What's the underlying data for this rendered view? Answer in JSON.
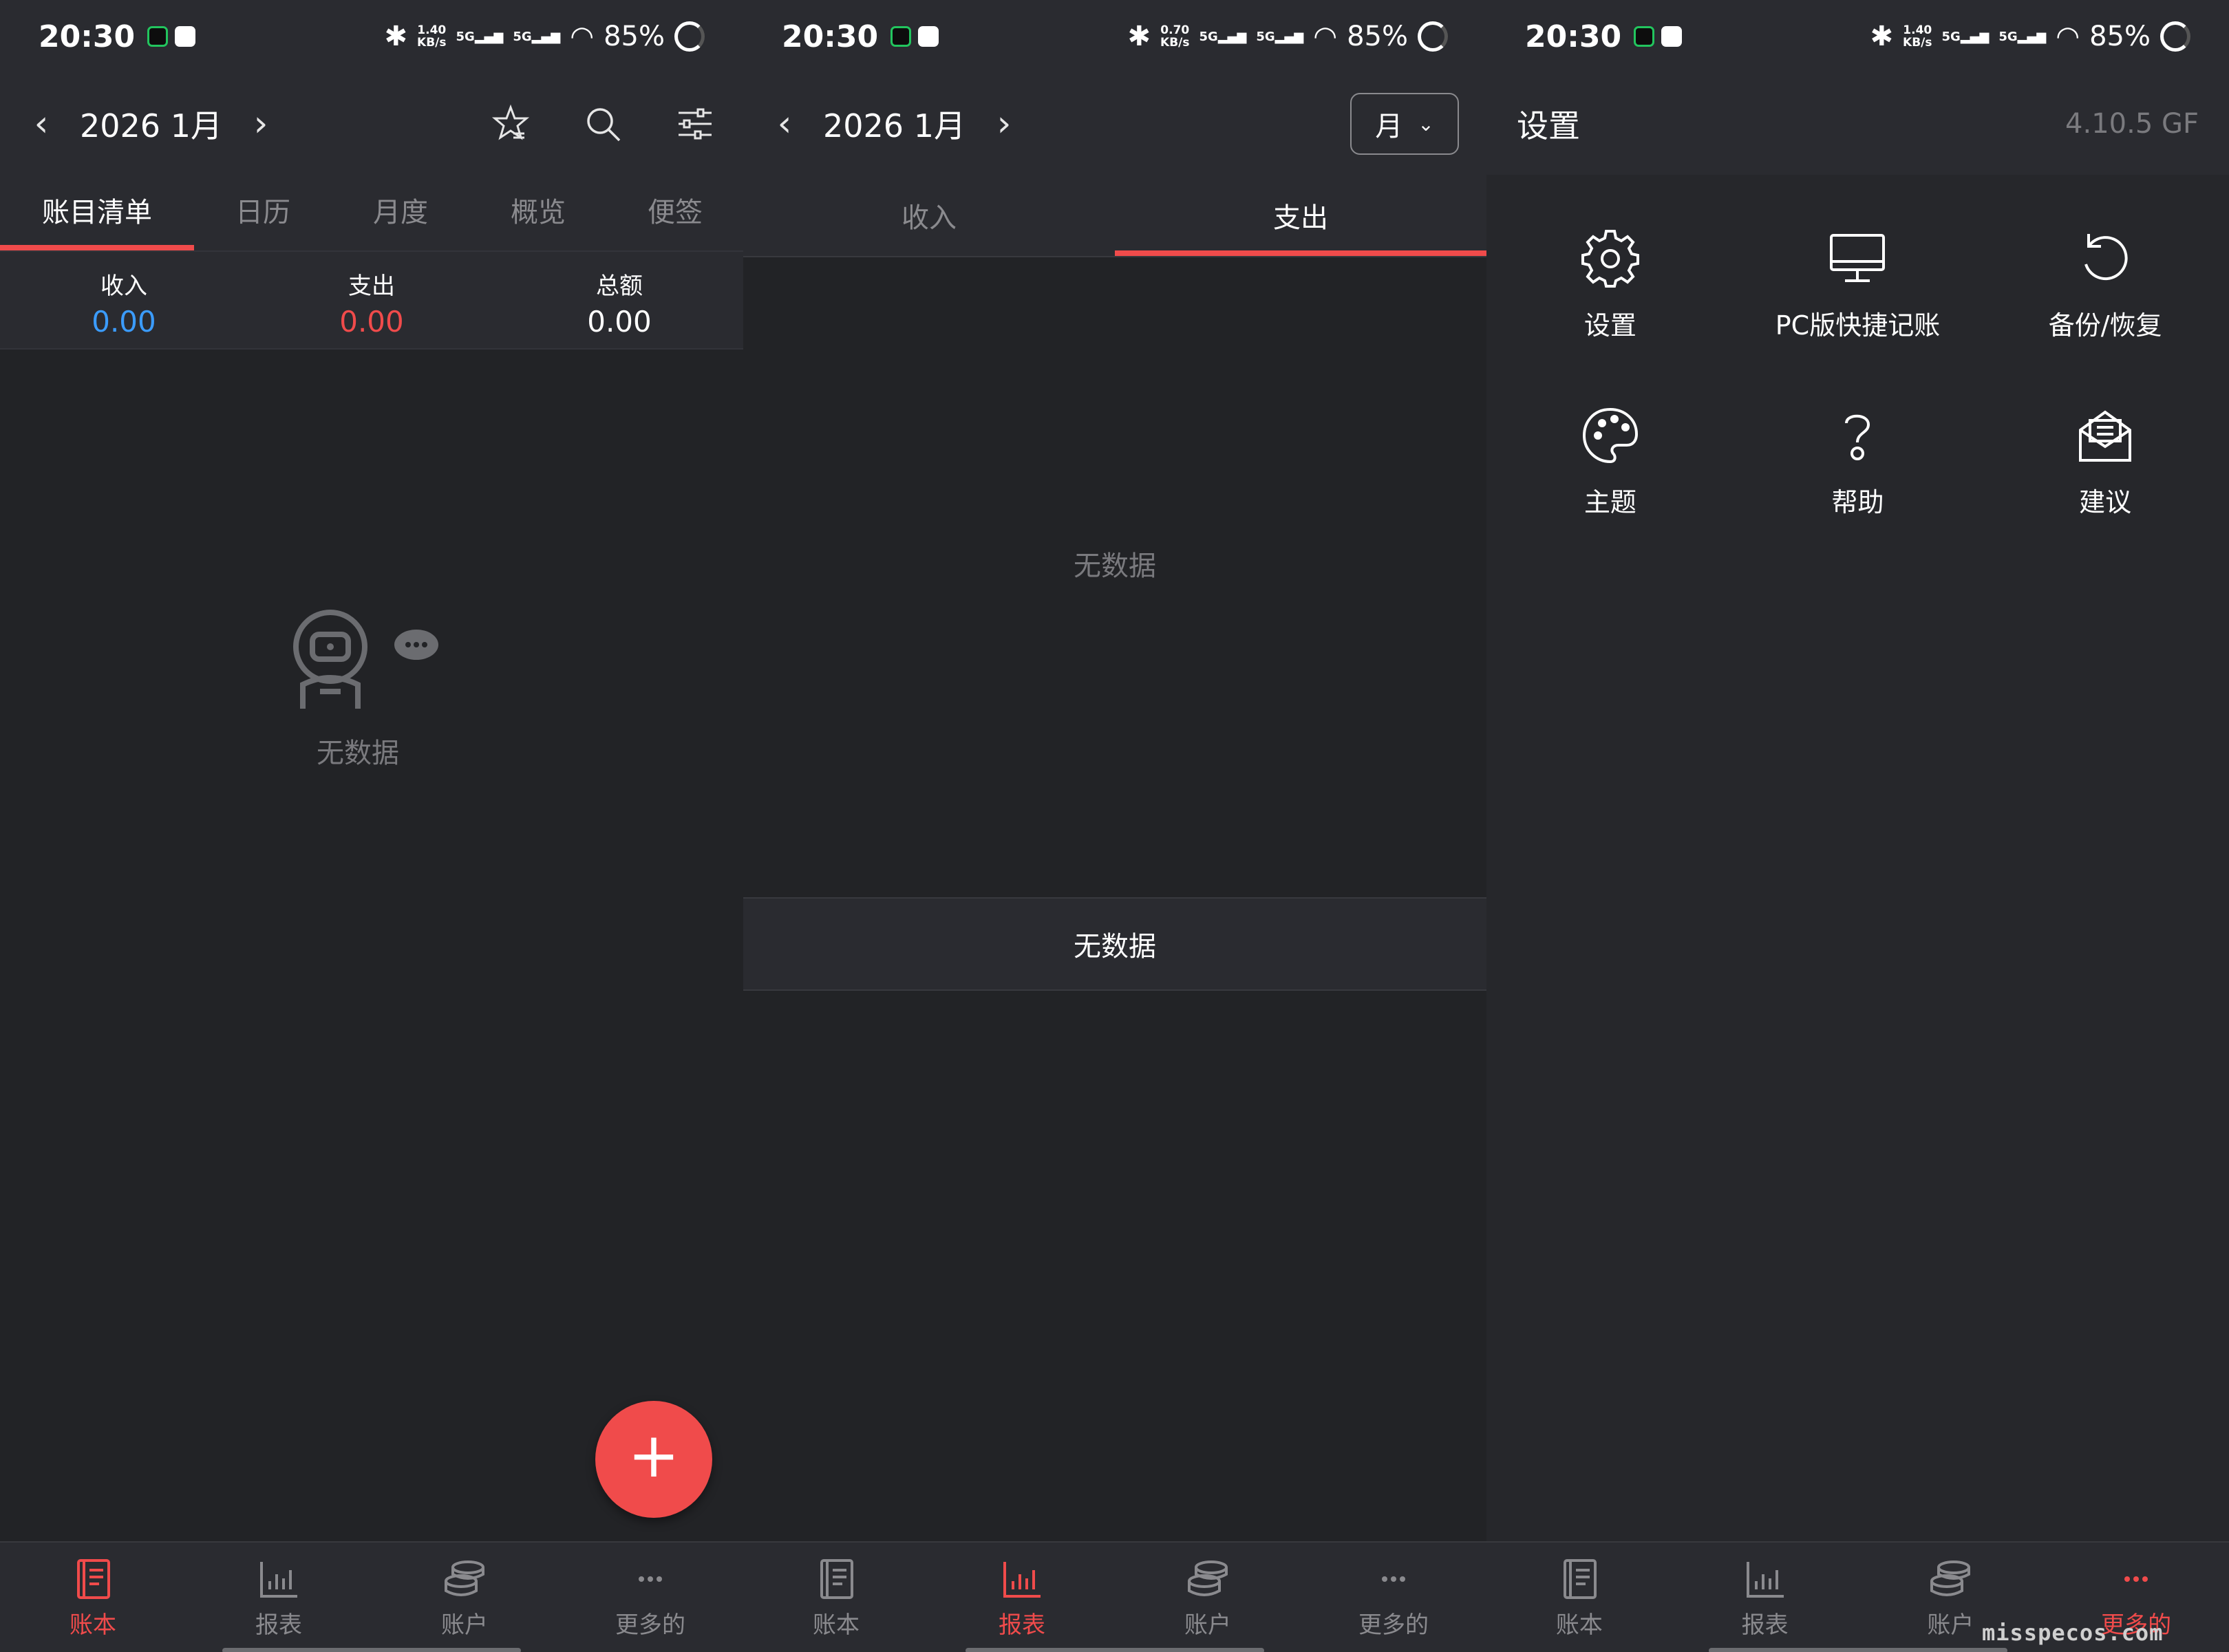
{
  "status_bar": {
    "time": "20:30",
    "battery": "85%",
    "screens": [
      {
        "net_speed": "1.40",
        "net_unit": "KB/s"
      },
      {
        "net_speed": "0.70",
        "net_unit": "KB/s"
      },
      {
        "net_speed": "1.40",
        "net_unit": "KB/s"
      }
    ],
    "sig1": "5G",
    "sig2": "5G"
  },
  "ledger": {
    "month": "2026 1月",
    "tabs": [
      "账目清单",
      "日历",
      "月度",
      "概览",
      "便签"
    ],
    "summary": {
      "income_label": "收入",
      "income_value": "0.00",
      "expense_label": "支出",
      "expense_value": "0.00",
      "total_label": "总额",
      "total_value": "0.00"
    },
    "empty_text": "无数据",
    "fab": "+"
  },
  "report": {
    "month": "2026 1月",
    "period": "月",
    "tabs": [
      "收入",
      "支出"
    ],
    "empty_chart_text": "无数据",
    "empty_list_text": "无数据"
  },
  "more": {
    "title": "设置",
    "version": "4.10.5 GF",
    "items": [
      {
        "label": "设置",
        "icon": "gear-icon"
      },
      {
        "label": "PC版快捷记账",
        "icon": "monitor-icon"
      },
      {
        "label": "备份/恢复",
        "icon": "restore-icon"
      },
      {
        "label": "主题",
        "icon": "palette-icon"
      },
      {
        "label": "帮助",
        "icon": "help-icon"
      },
      {
        "label": "建议",
        "icon": "mail-icon"
      }
    ]
  },
  "bottom_nav": [
    "账本",
    "报表",
    "账户",
    "更多的"
  ],
  "watermark": "misspecos.com",
  "colors": {
    "accent": "#f04b4b",
    "income": "#3b9cff",
    "expense": "#f04b4b",
    "background": "#222326",
    "bar": "#2a2b30"
  }
}
